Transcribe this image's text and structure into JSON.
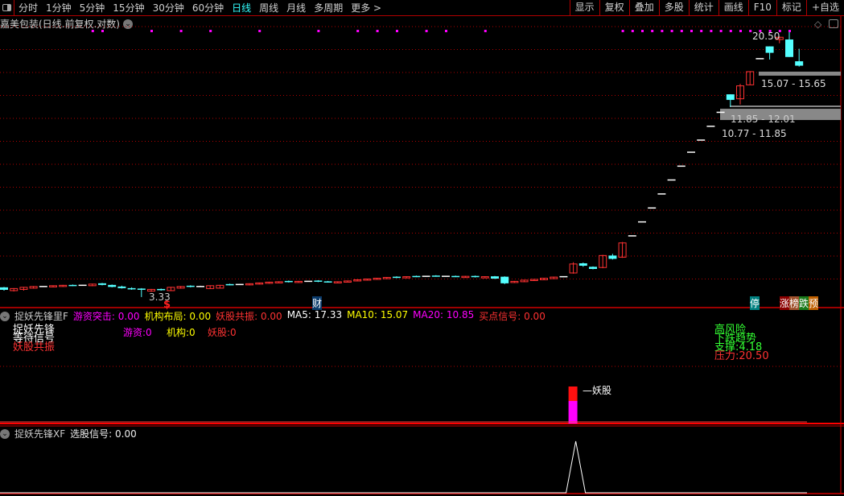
{
  "toolbar": {
    "periods": [
      "分时",
      "1分钟",
      "5分钟",
      "15分钟",
      "30分钟",
      "60分钟",
      "日线",
      "周线",
      "月线",
      "多周期",
      "更多 >"
    ],
    "active_period": "日线",
    "right_buttons": [
      "显示",
      "复权",
      "叠加",
      "多股",
      "统计",
      "画线",
      "F10",
      "标记",
      "+自选"
    ]
  },
  "stock": {
    "title": "嘉美包装(日线.前复权.对数)"
  },
  "colors": {
    "up": "#ff3232",
    "down": "#54ffff",
    "grid": "#b00000",
    "magenta": "#ff00ff",
    "yellow": "#ffff00"
  },
  "main_chart": {
    "scale": "log",
    "high_label": "20.50",
    "low_label": "3.33",
    "gaps": [
      {
        "label": "11.85 - 12.01",
        "low": 11.85,
        "high": 12.01
      },
      {
        "label": "15.07 - 15.65",
        "low": 15.07,
        "high": 15.65
      }
    ],
    "gap_text": "10.77 - 11.85",
    "badges": {
      "cai": "财",
      "ting": "停",
      "zhang": "涨",
      "bang": "榜",
      "die": "跌",
      "yu": "预"
    },
    "candles": [
      [
        3.58,
        3.52,
        3.59,
        3.5
      ],
      [
        3.5,
        3.55,
        3.56,
        3.48
      ],
      [
        3.53,
        3.58,
        3.59,
        3.5
      ],
      [
        3.56,
        3.6,
        3.61,
        3.55
      ],
      [
        3.6,
        3.6,
        3.61,
        3.59
      ],
      [
        3.59,
        3.62,
        3.63,
        3.58
      ],
      [
        3.6,
        3.63,
        3.64,
        3.59
      ],
      [
        3.64,
        3.62,
        3.65,
        3.61
      ],
      [
        3.63,
        3.63,
        3.64,
        3.62
      ],
      [
        3.62,
        3.66,
        3.67,
        3.61
      ],
      [
        3.68,
        3.64,
        3.69,
        3.63
      ],
      [
        3.64,
        3.59,
        3.65,
        3.58
      ],
      [
        3.6,
        3.56,
        3.62,
        3.55
      ],
      [
        3.56,
        3.53,
        3.58,
        3.52
      ],
      [
        3.55,
        3.52,
        3.56,
        3.35
      ],
      [
        3.49,
        3.53,
        3.54,
        3.47
      ],
      [
        3.54,
        3.51,
        3.55,
        3.5
      ],
      [
        3.5,
        3.58,
        3.59,
        3.49
      ],
      [
        3.56,
        3.6,
        3.61,
        3.55
      ],
      [
        3.62,
        3.59,
        3.63,
        3.58
      ],
      [
        3.6,
        3.6,
        3.62,
        3.59
      ],
      [
        3.55,
        3.62,
        3.63,
        3.54
      ],
      [
        3.56,
        3.63,
        3.64,
        3.56
      ],
      [
        3.66,
        3.64,
        3.67,
        3.63
      ],
      [
        3.65,
        3.65,
        3.66,
        3.64
      ],
      [
        3.64,
        3.67,
        3.68,
        3.63
      ],
      [
        3.66,
        3.69,
        3.7,
        3.65
      ],
      [
        3.68,
        3.71,
        3.72,
        3.67
      ],
      [
        3.7,
        3.72,
        3.73,
        3.69
      ],
      [
        3.74,
        3.71,
        3.75,
        3.7
      ],
      [
        3.71,
        3.73,
        3.74,
        3.7
      ],
      [
        3.73,
        3.73,
        3.74,
        3.72
      ],
      [
        3.75,
        3.72,
        3.76,
        3.71
      ],
      [
        3.73,
        3.71,
        3.74,
        3.7
      ],
      [
        3.7,
        3.72,
        3.73,
        3.69
      ],
      [
        3.72,
        3.74,
        3.75,
        3.71
      ],
      [
        3.74,
        3.77,
        3.78,
        3.73
      ],
      [
        3.76,
        3.79,
        3.8,
        3.75
      ],
      [
        3.78,
        3.81,
        3.82,
        3.77
      ],
      [
        3.8,
        3.83,
        3.84,
        3.79
      ],
      [
        3.85,
        3.82,
        3.86,
        3.81
      ],
      [
        3.82,
        3.85,
        3.86,
        3.81
      ],
      [
        3.87,
        3.85,
        3.88,
        3.84
      ],
      [
        3.86,
        3.86,
        3.87,
        3.85
      ],
      [
        3.88,
        3.86,
        3.89,
        3.85
      ],
      [
        3.86,
        3.86,
        3.87,
        3.85
      ],
      [
        3.87,
        3.85,
        3.88,
        3.84
      ],
      [
        3.84,
        3.86,
        3.87,
        3.83
      ],
      [
        3.87,
        3.84,
        3.88,
        3.83
      ],
      [
        3.84,
        3.85,
        3.86,
        3.83
      ],
      [
        3.86,
        3.8,
        3.87,
        3.79
      ],
      [
        3.85,
        3.68,
        3.86,
        3.66
      ],
      [
        3.7,
        3.73,
        3.74,
        3.69
      ],
      [
        3.72,
        3.76,
        3.77,
        3.71
      ],
      [
        3.75,
        3.78,
        3.79,
        3.74
      ],
      [
        3.77,
        3.81,
        3.82,
        3.76
      ],
      [
        3.8,
        3.84,
        3.85,
        3.79
      ],
      [
        3.85,
        3.85,
        3.86,
        3.84
      ],
      [
        3.95,
        4.2,
        4.25,
        3.93
      ],
      [
        4.22,
        4.15,
        4.24,
        4.12
      ],
      [
        4.12,
        4.06,
        4.13,
        4.05
      ],
      [
        4.1,
        4.45,
        4.47,
        4.08
      ],
      [
        4.45,
        4.35,
        4.5,
        4.33
      ],
      [
        4.4,
        4.85,
        4.88,
        4.38
      ],
      [
        5.09,
        5.09,
        5.09,
        5.09
      ],
      [
        5.6,
        5.6,
        5.6,
        5.6
      ],
      [
        6.16,
        6.16,
        6.16,
        6.16
      ],
      [
        6.78,
        6.78,
        6.78,
        6.78
      ],
      [
        7.46,
        7.46,
        7.46,
        7.46
      ],
      [
        8.2,
        8.2,
        8.2,
        8.2
      ],
      [
        9.02,
        9.02,
        9.02,
        9.02
      ],
      [
        9.8,
        9.8,
        9.8,
        9.8
      ],
      [
        10.77,
        10.77,
        10.77,
        10.77
      ],
      [
        11.85,
        11.85,
        11.85,
        11.85
      ],
      [
        13.4,
        12.9,
        13.4,
        12.3
      ],
      [
        13.0,
        14.2,
        14.4,
        12.5
      ],
      [
        14.3,
        15.65,
        15.7,
        14.3
      ],
      [
        17.1,
        17.1,
        17.1,
        17.1
      ],
      [
        18.6,
        17.8,
        18.6,
        17.0
      ],
      [
        19.5,
        19.8,
        19.9,
        19.0
      ],
      [
        19.5,
        17.3,
        20.5,
        17.3
      ],
      [
        16.8,
        16.3,
        18.3,
        16.2
      ]
    ],
    "signal_dots_idx": [
      9,
      10,
      15,
      18,
      21,
      26,
      32,
      36,
      38,
      40,
      43,
      45,
      49,
      63,
      64,
      65,
      66,
      67,
      68,
      69,
      70,
      71,
      72,
      73,
      74,
      75,
      76,
      77,
      78,
      79,
      80
    ]
  },
  "indicator1": {
    "name": "捉妖先锋里F",
    "values": [
      {
        "label": "游资突击",
        "value": "0.00",
        "color": "#ff00ff"
      },
      {
        "label": "机构布局",
        "value": "0.00",
        "color": "#ffff00"
      },
      {
        "label": "妖股共振",
        "value": "0.00",
        "color": "#ff3232"
      },
      {
        "label": "MA5",
        "value": "17.33",
        "color": "#ffffff"
      },
      {
        "label": "MA10",
        "value": "15.07",
        "color": "#ffff00"
      },
      {
        "label": "MA20",
        "value": "10.85",
        "color": "#ff00ff"
      },
      {
        "label": "买点信号",
        "value": "0.00",
        "color": "#ff3232"
      }
    ],
    "text_left": [
      "捉妖先锋",
      "等待信号",
      "妖股共振"
    ],
    "counts": [
      {
        "label": "游资:0",
        "color": "#ff00ff"
      },
      {
        "label": "机构:0",
        "color": "#ffff00"
      },
      {
        "label": "妖股:0",
        "color": "#ff3232"
      }
    ],
    "right_info": {
      "risk": "高风险",
      "trend": "下跌趋势",
      "support": "支撑:4.18",
      "pressure": "压力:20.50"
    },
    "bar_label": "妖股",
    "bar_index": 58
  },
  "indicator2": {
    "name": "捉妖先锋XF",
    "value_label": "选股信号",
    "value": "0.00",
    "signal_index": 58
  }
}
